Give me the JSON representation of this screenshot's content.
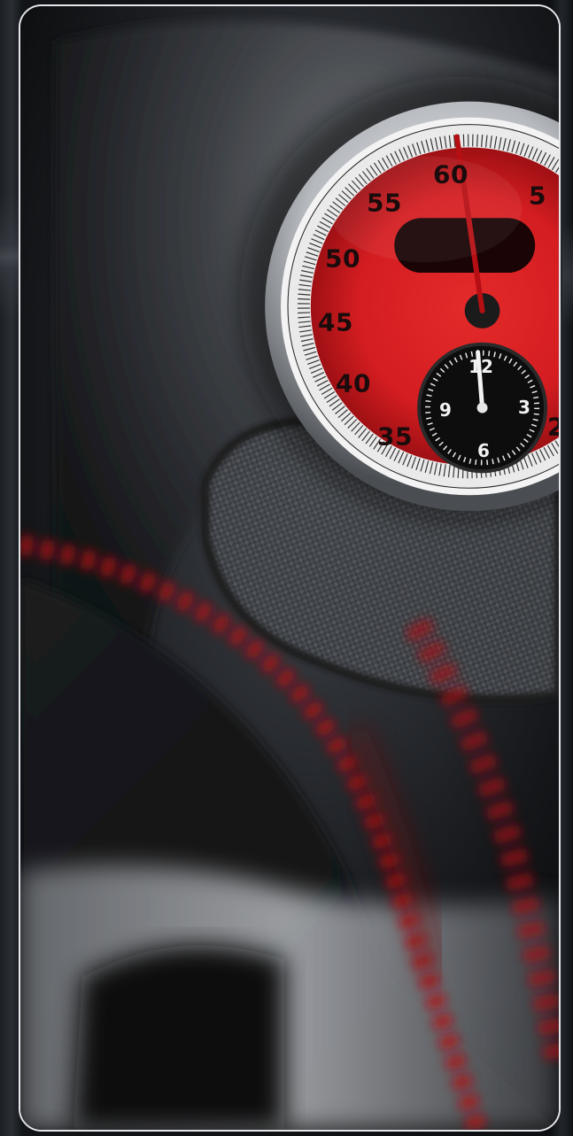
{
  "gauge": {
    "outer_labels": [
      "60",
      "5",
      "55",
      "50",
      "45",
      "40",
      "35",
      "2"
    ],
    "sub_dial_labels": [
      "12",
      "3",
      "6",
      "9"
    ]
  },
  "colors": {
    "dial_red": "#d61e22",
    "bezel": "#c9ccd1",
    "background": "#0b0c0e",
    "stitching": "#b01018"
  }
}
